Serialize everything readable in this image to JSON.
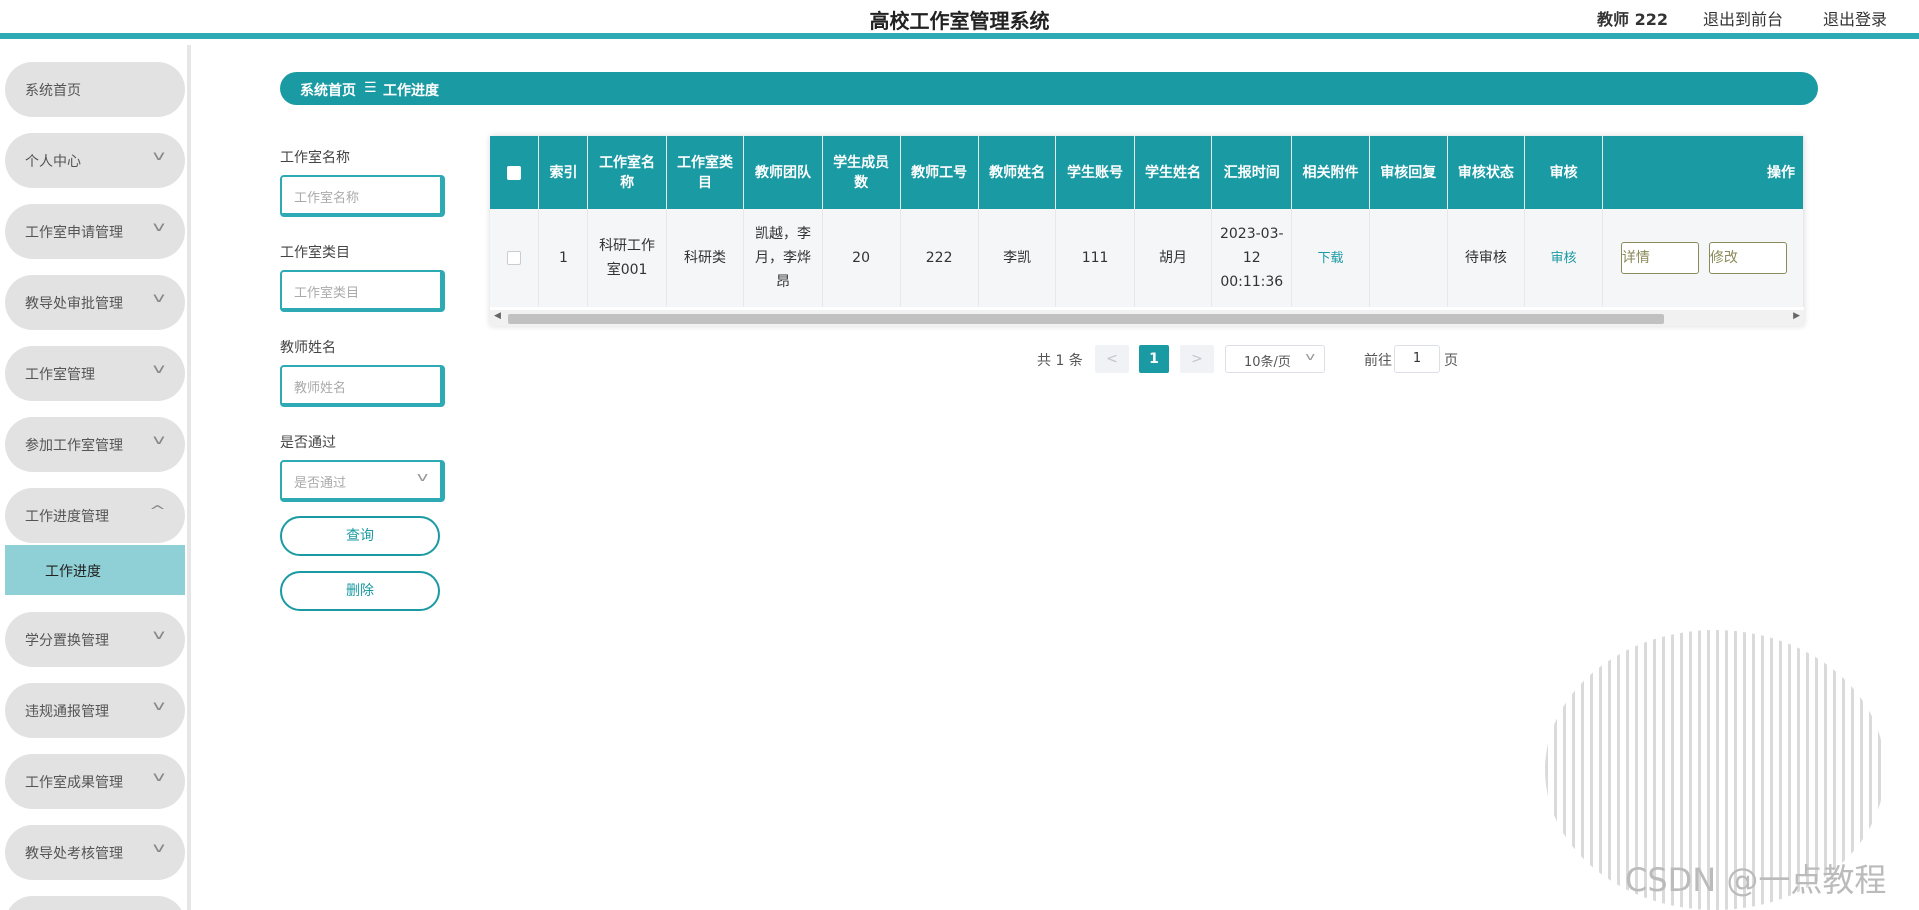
{
  "header": {
    "title": "高校工作室管理系统",
    "user": "教师 222",
    "to_front": "退出到前台",
    "logout": "退出登录"
  },
  "sidebar": {
    "items": [
      {
        "label": "系统首页"
      },
      {
        "label": "个人中心"
      },
      {
        "label": "工作室申请管理"
      },
      {
        "label": "教导处审批管理"
      },
      {
        "label": "工作室管理"
      },
      {
        "label": "参加工作室管理"
      },
      {
        "label": "工作进度管理",
        "expanded": true
      },
      {
        "label": "学分置换管理"
      },
      {
        "label": "违规通报管理"
      },
      {
        "label": "工作室成果管理"
      },
      {
        "label": "教导处考核管理"
      }
    ],
    "submenu": {
      "label": "工作进度"
    },
    "icons": {
      "collapsed": "chevron-down-icon",
      "expanded": "chevron-up-icon"
    }
  },
  "breadcrumb": {
    "home": "系统首页",
    "separator": "☰",
    "current": "工作进度"
  },
  "search": {
    "studio_name": {
      "label": "工作室名称",
      "placeholder": "工作室名称"
    },
    "studio_category": {
      "label": "工作室类目",
      "placeholder": "工作室类目"
    },
    "teacher_name": {
      "label": "教师姓名",
      "placeholder": "教师姓名"
    },
    "passed": {
      "label": "是否通过",
      "placeholder": "是否通过"
    },
    "query_button": "查询",
    "delete_button": "删除"
  },
  "table": {
    "headers": [
      "索引",
      "工作室名称",
      "工作室类目",
      "教师团队",
      "学生成员数",
      "教师工号",
      "教师姓名",
      "学生账号",
      "学生姓名",
      "汇报时间",
      "相关附件",
      "审核回复",
      "审核状态",
      "审核",
      "操作"
    ],
    "rows": [
      {
        "index": "1",
        "studio_name": "科研工作室001",
        "category": "科研类",
        "team": "凯越，李月，李烨昂",
        "members": "20",
        "teacher_id": "222",
        "teacher_name": "李凯",
        "student_account": "111",
        "student_name": "胡月",
        "report_time": "2023-03-12 00:11:36",
        "attachment": "下载",
        "reply": "",
        "status": "待审核",
        "audit": "审核",
        "detail_button": "详情",
        "edit_button": "修改"
      }
    ]
  },
  "pagination": {
    "total": "共 1 条",
    "prev": "<",
    "page": "1",
    "next": ">",
    "page_size": "10条/页",
    "goto_label": "前往",
    "goto_value": "1",
    "page_suffix": "页"
  },
  "watermark": "CSDN @一点教程",
  "colors": {
    "accent": "#1a9aa3",
    "sidebar_item": "#e2e2e2",
    "sidebar_active": "#8fcfd6"
  }
}
